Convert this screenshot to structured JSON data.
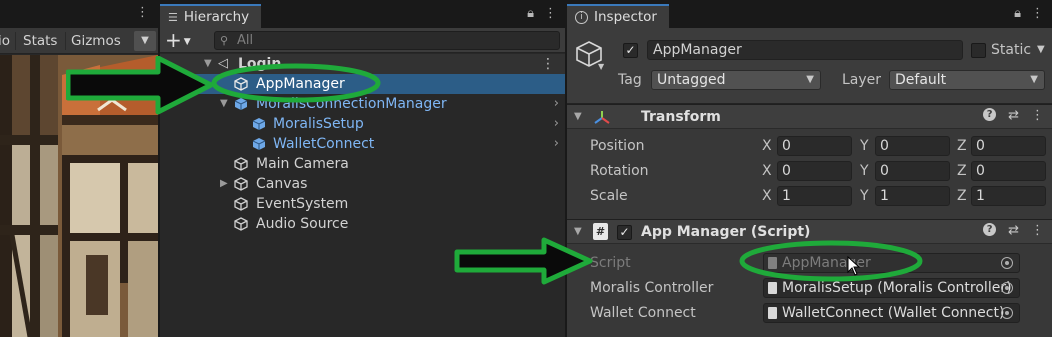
{
  "scene": {
    "toolbar": {
      "io_label": "io",
      "stats_label": "Stats",
      "gizmos_label": "Gizmos"
    }
  },
  "hierarchy": {
    "tab_label": "Hierarchy",
    "add_label": "+",
    "search_placeholder": "All",
    "items": [
      {
        "label": "Login"
      },
      {
        "label": "AppManager"
      },
      {
        "label": "MoralisConnectionManager"
      },
      {
        "label": "MoralisSetup"
      },
      {
        "label": "WalletConnect"
      },
      {
        "label": "Main Camera"
      },
      {
        "label": "Canvas"
      },
      {
        "label": "EventSystem"
      },
      {
        "label": "Audio Source"
      }
    ]
  },
  "inspector": {
    "tab_label": "Inspector",
    "object_name": "AppManager",
    "static_label": "Static",
    "tag_label": "Tag",
    "tag_value": "Untagged",
    "layer_label": "Layer",
    "layer_value": "Default",
    "transform": {
      "title": "Transform",
      "rows": [
        {
          "label": "Position",
          "x": "0",
          "y": "0",
          "z": "0"
        },
        {
          "label": "Rotation",
          "x": "0",
          "y": "0",
          "z": "0"
        },
        {
          "label": "Scale",
          "x": "1",
          "y": "1",
          "z": "1"
        }
      ],
      "axis_x": "X",
      "axis_y": "Y",
      "axis_z": "Z"
    },
    "script_component": {
      "title": "App Manager (Script)",
      "fields": [
        {
          "label": "Script",
          "value": "AppManager"
        },
        {
          "label": "Moralis Controller",
          "value": "MoralisSetup (Moralis Controller)"
        },
        {
          "label": "Wallet Connect",
          "value": "WalletConnect (Wallet Connect)"
        }
      ]
    }
  },
  "colors": {
    "selection": "#2c5d87",
    "highlight_green": "#1faa3a",
    "prefab_blue": "#7fb6f4",
    "tab_accent": "#3a79bb"
  }
}
